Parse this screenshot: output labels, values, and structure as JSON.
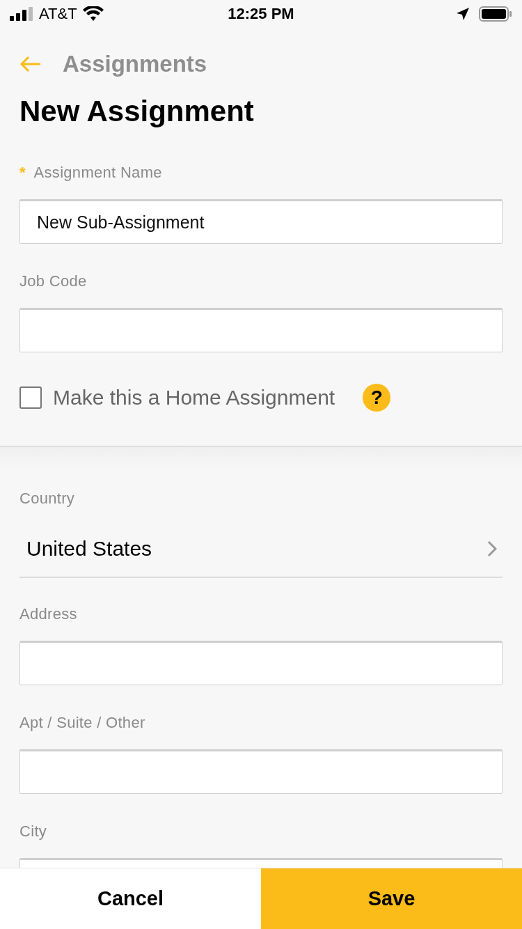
{
  "status_bar": {
    "carrier": "AT&T",
    "time": "12:25 PM"
  },
  "header": {
    "back_label": "Assignments",
    "title": "New Assignment"
  },
  "sections": [
    {
      "fields": [
        {
          "kind": "text",
          "label": "Assignment Name",
          "required_mark": "*",
          "value": "New Sub-Assignment"
        },
        {
          "kind": "text",
          "label": "Job Code"
        },
        {
          "kind": "checkbox",
          "label": "Make this a Home Assignment",
          "checked": false,
          "help": "?"
        }
      ]
    },
    {
      "fields": [
        {
          "kind": "select",
          "label": "Country",
          "value": "United States"
        },
        {
          "kind": "text",
          "label": "Address"
        },
        {
          "kind": "text",
          "label": "Apt / Suite / Other"
        },
        {
          "kind": "text",
          "label": "City"
        }
      ]
    }
  ],
  "buttons": [
    {
      "label": "Cancel",
      "kind": "secondary"
    },
    {
      "label": "Save",
      "kind": "primary"
    }
  ]
}
